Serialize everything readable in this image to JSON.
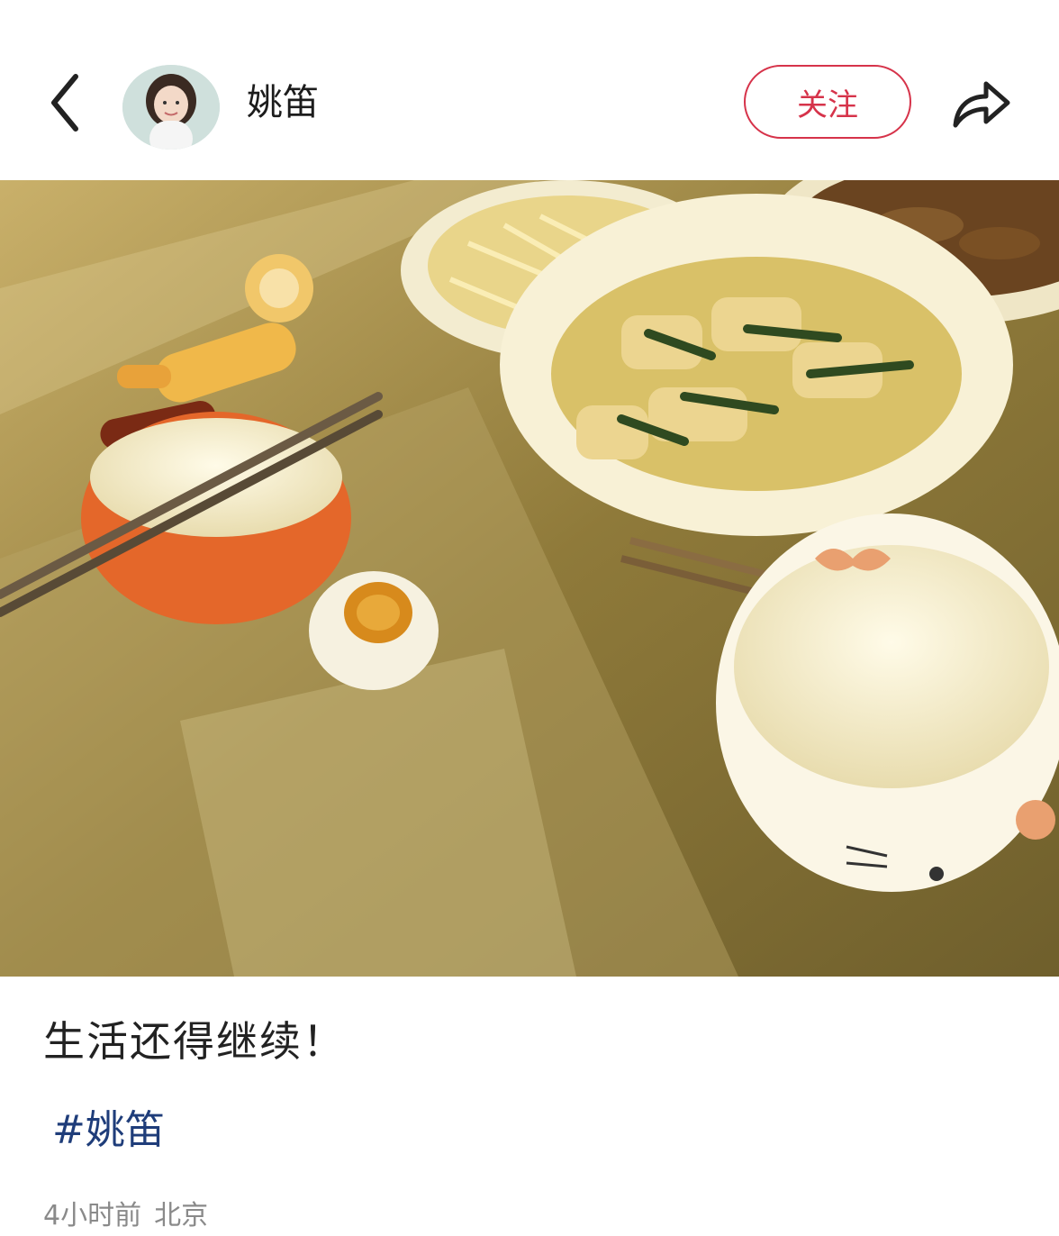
{
  "header": {
    "username": "姚笛",
    "follow_label": "关注",
    "back_icon": "chevron-left-icon",
    "share_icon": "share-arrow-icon"
  },
  "post": {
    "photo_alt": "photo",
    "caption": "生活还得继续！",
    "hashtag": "#姚笛",
    "time": "4小时前",
    "location": "北京"
  },
  "colors": {
    "accent": "#d6334a",
    "hashtag": "#1f3d7a",
    "meta": "#8a8a8a"
  }
}
